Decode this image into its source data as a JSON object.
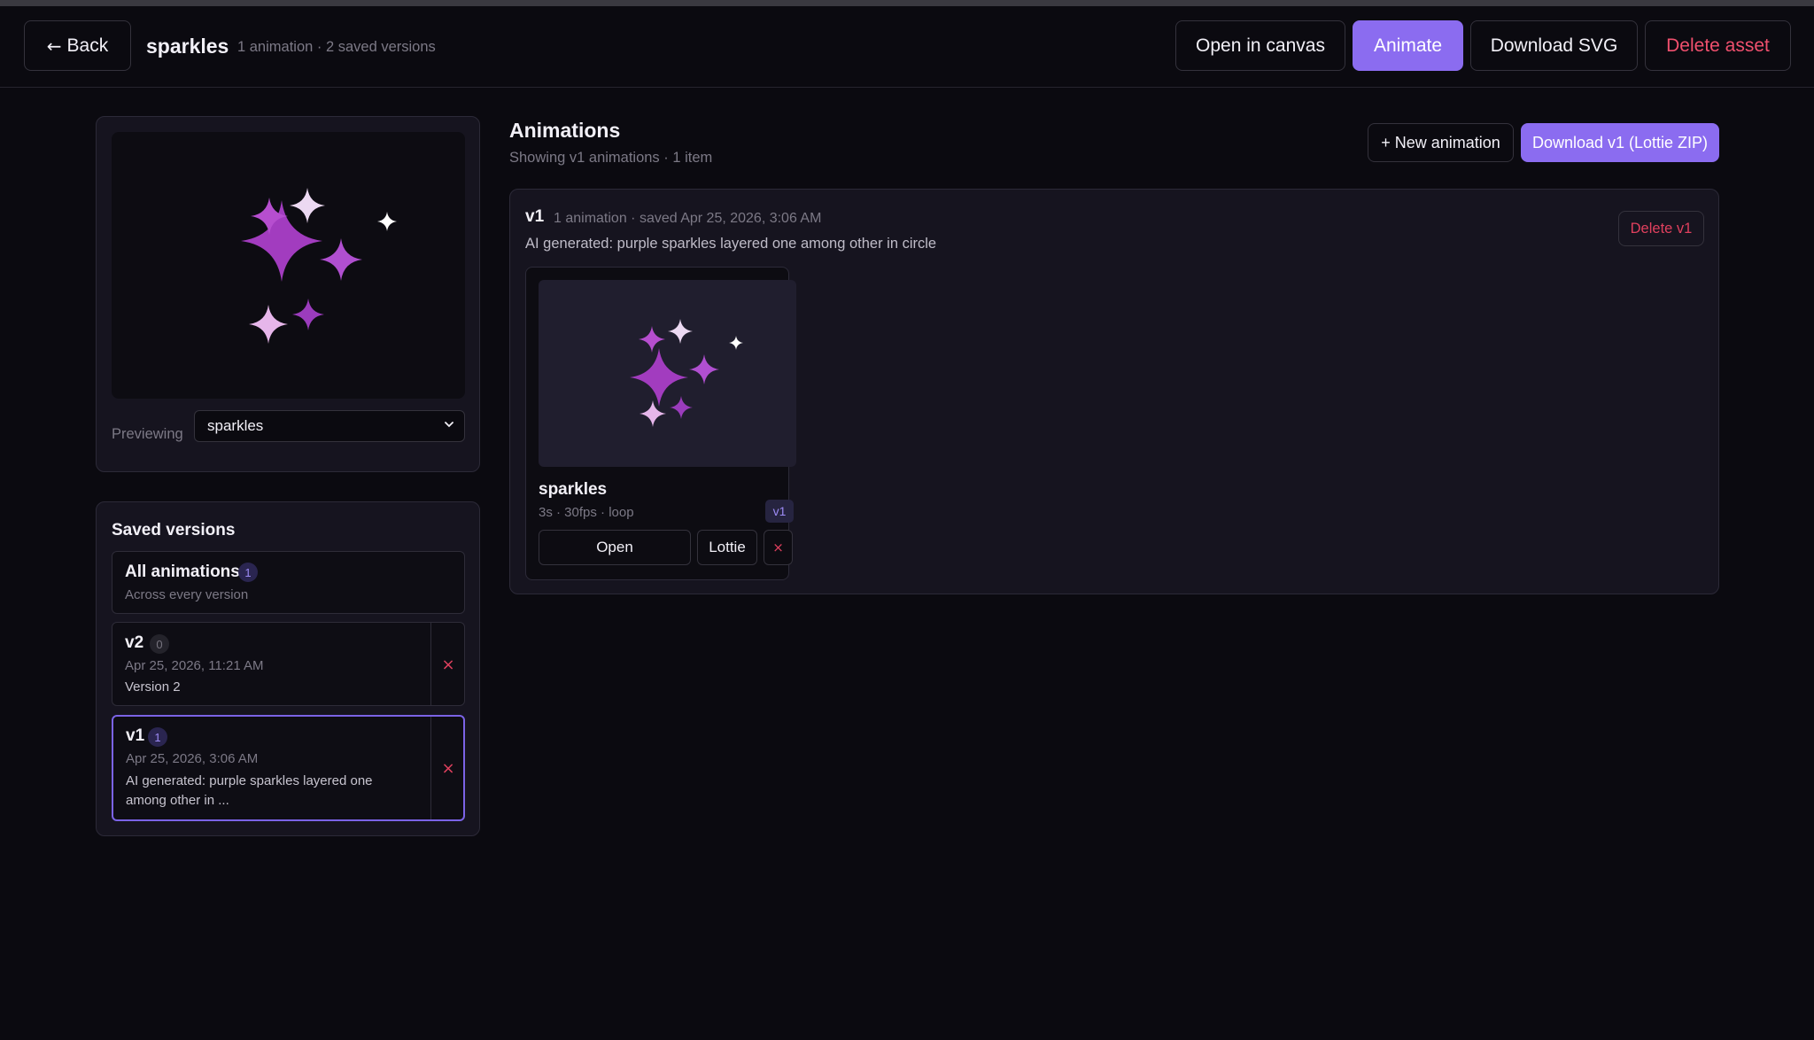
{
  "header": {
    "back_label": "Back",
    "asset_title": "sparkles",
    "asset_meta": "1 animation · 2 saved versions",
    "open_canvas": "Open in canvas",
    "animate": "Animate",
    "download_svg": "Download SVG",
    "delete_asset": "Delete asset"
  },
  "preview": {
    "previewing_label": "Previewing",
    "selected": "sparkles"
  },
  "versions": {
    "title": "Saved versions",
    "all": {
      "name": "All animations",
      "count": "1",
      "sub": "Across every version"
    },
    "items": [
      {
        "name": "v2",
        "count": "0",
        "date": "Apr 25, 2026, 11:21 AM",
        "desc": "Version 2"
      },
      {
        "name": "v1",
        "count": "1",
        "date": "Apr 25, 2026, 3:06 AM",
        "desc": "AI generated: purple sparkles layered one among other in ..."
      }
    ]
  },
  "main": {
    "title": "Animations",
    "subtitle": "Showing v1 animations · 1 item",
    "new_animation": "+ New animation",
    "download_lottie": "Download v1 (Lottie ZIP)"
  },
  "group": {
    "name": "v1",
    "meta": "1 animation · saved Apr 25, 2026, 3:06 AM",
    "desc": "AI generated: purple sparkles layered one among other in circle",
    "delete_label": "Delete v1"
  },
  "card": {
    "name": "sparkles",
    "meta": "3s · 30fps · loop",
    "badge": "v1",
    "open": "Open",
    "lottie": "Lottie",
    "remove": "×"
  },
  "colors": {
    "accent": "#8b6cf0",
    "danger": "#e0405e",
    "sparkle_purple": "#a23cbf",
    "sparkle_light": "#e9b8ea"
  }
}
